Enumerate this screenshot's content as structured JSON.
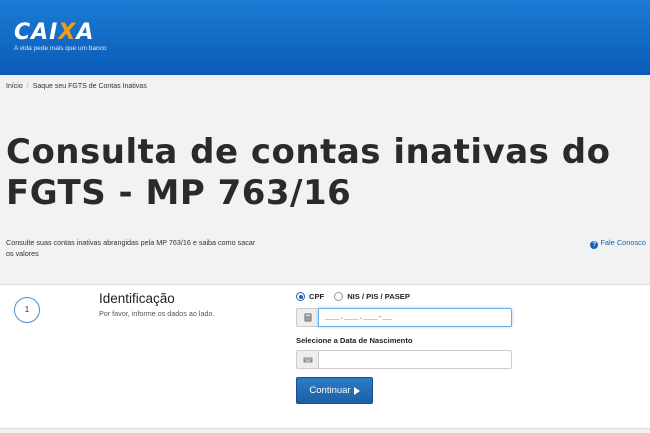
{
  "brand": {
    "name_pre": "CAI",
    "name_x": "X",
    "name_post": "A",
    "tagline": "A vida pede mais que um banco",
    "accent": "#f39c12",
    "header_color": "#0a5cb8"
  },
  "breadcrumb": {
    "home": "Início",
    "separator": "/",
    "current": "Saque seu FGTS de Contas Inativas"
  },
  "page": {
    "title": "Consulta de contas inativas do FGTS - MP 763/16",
    "description": "Consulte suas contas inativas abrangidas pela MP 763/16 e saiba como sacar os valores",
    "contact_label": "Fale Conosco"
  },
  "form": {
    "step_number": "1",
    "section_title": "Identificação",
    "section_subtitle": "Por favor, informe os dados ao lado.",
    "radio_options": [
      {
        "label": "CPF",
        "selected": true
      },
      {
        "label": "NIS / PIS / PASEP",
        "selected": false
      }
    ],
    "id_field": {
      "value": "___.___.___-__",
      "icon": "calculator-icon"
    },
    "date_label": "Selecione a Data de Nascimento",
    "date_field": {
      "value": "",
      "icon": "keyboard-icon"
    },
    "submit_label": "Continuar"
  }
}
